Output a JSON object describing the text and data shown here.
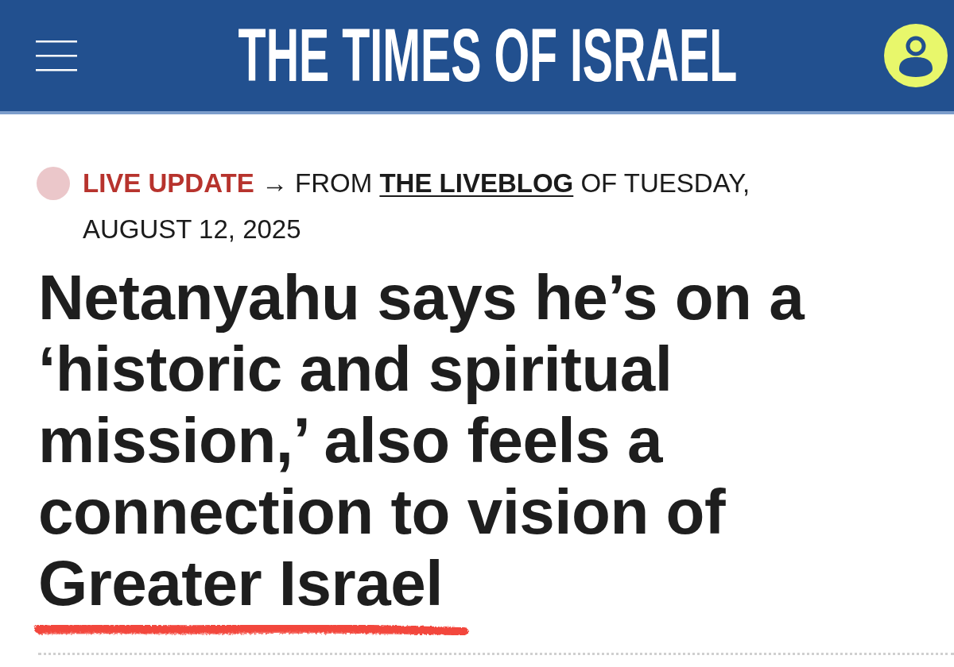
{
  "header": {
    "title": "THE TIMES OF ISRAEL"
  },
  "dateline": {
    "label": "LIVE UPDATE",
    "lead": "→ FROM",
    "link": "THE LIVEBLOG",
    "rest": "OF TUESDAY, AUGUST 12, 2025"
  },
  "headline": "Netanyahu says he’s on a ‘historic and spiritual mission,’ also feels a connection to vision of Greater Israel"
}
